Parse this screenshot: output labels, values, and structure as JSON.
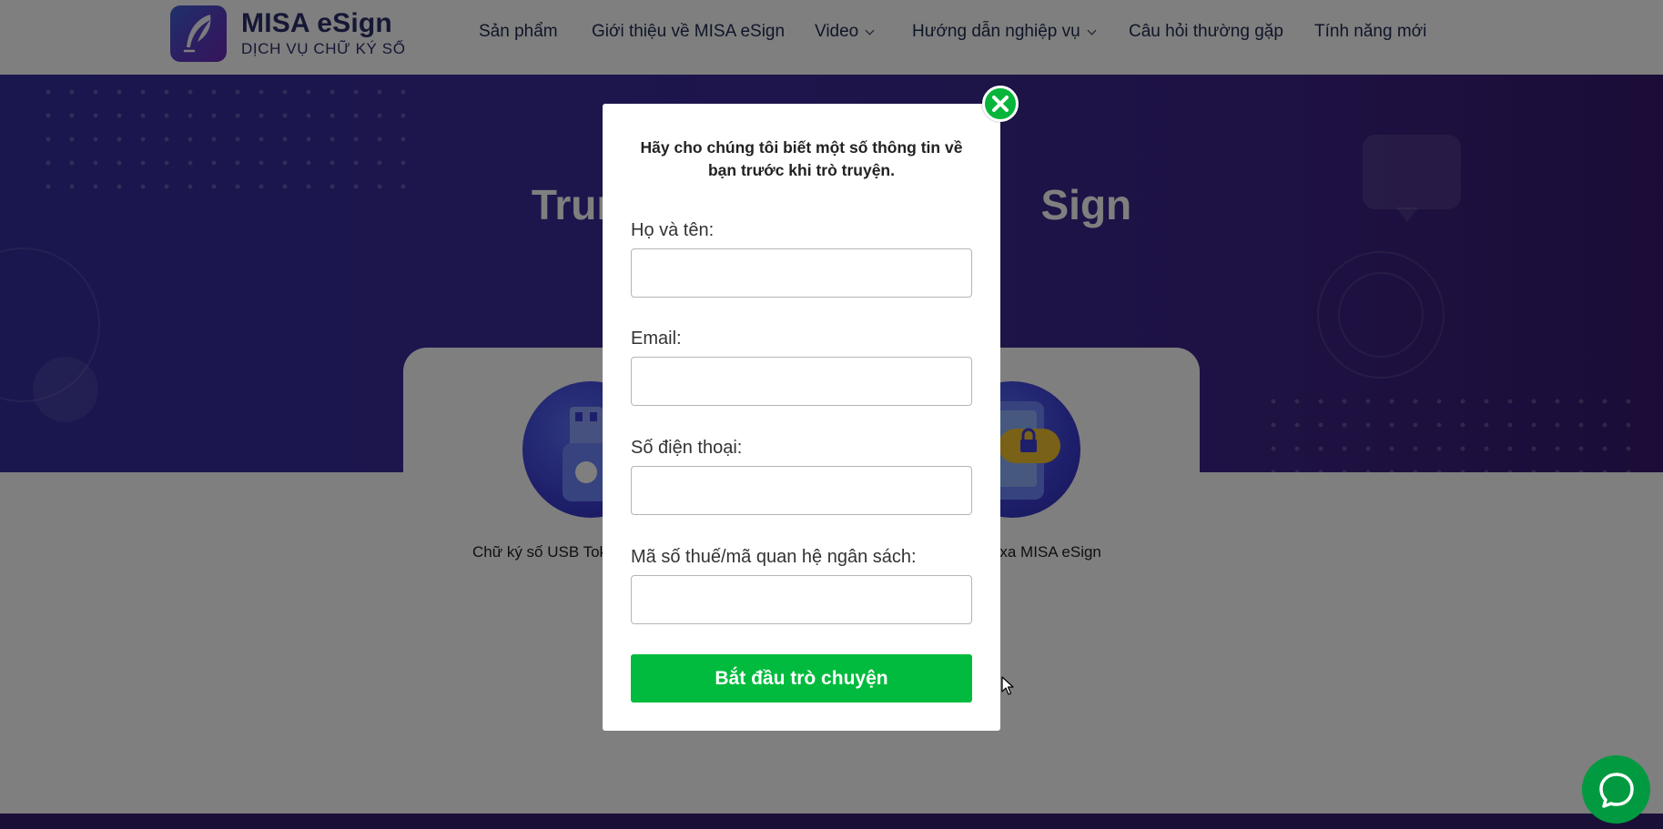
{
  "brand": {
    "title": "MISA eSign",
    "subtitle": "DỊCH VỤ CHỮ KÝ SỐ"
  },
  "nav": [
    {
      "label": "Sản phẩm",
      "has_dropdown": false
    },
    {
      "label": "Giới thiệu về MISA eSign",
      "has_dropdown": false
    },
    {
      "label": "Video",
      "has_dropdown": true
    },
    {
      "label": "Hướng dẫn nghiệp vụ",
      "has_dropdown": true
    },
    {
      "label": "Câu hỏi thường gặp",
      "has_dropdown": false
    },
    {
      "label": "Tính năng mới",
      "has_dropdown": false
    }
  ],
  "hero": {
    "title_left": "Trun",
    "title_right": "Sign"
  },
  "products": [
    {
      "label": "Chữ ký số USB Tok",
      "icon": "usb-token-icon"
    },
    {
      "label": "r xa MISA eSign",
      "icon": "remote-signing-icon"
    }
  ],
  "modal": {
    "intro": "Hãy cho chúng tôi biết một số thông tin về bạn trước khi trò truyện.",
    "fields": [
      {
        "label": "Họ và tên:",
        "value": "",
        "placeholder": ""
      },
      {
        "label": "Email:",
        "value": "",
        "placeholder": ""
      },
      {
        "label": "Số điện thoại:",
        "value": "",
        "placeholder": ""
      },
      {
        "label": "Mã số thuế/mã quan hệ ngân sách:",
        "value": "",
        "placeholder": ""
      }
    ],
    "submit_label": "Bắt đầu trò chuyện",
    "close_icon": "close-icon"
  },
  "chat_widget": {
    "icon": "chat-bubble-icon"
  },
  "colors": {
    "accent_green": "#00bb3d",
    "close_green": "#07b53b",
    "hero_purple": "#3a2b98",
    "brand_navy": "#2a2f6a",
    "overlay": "rgba(0,0,0,0.5)"
  }
}
